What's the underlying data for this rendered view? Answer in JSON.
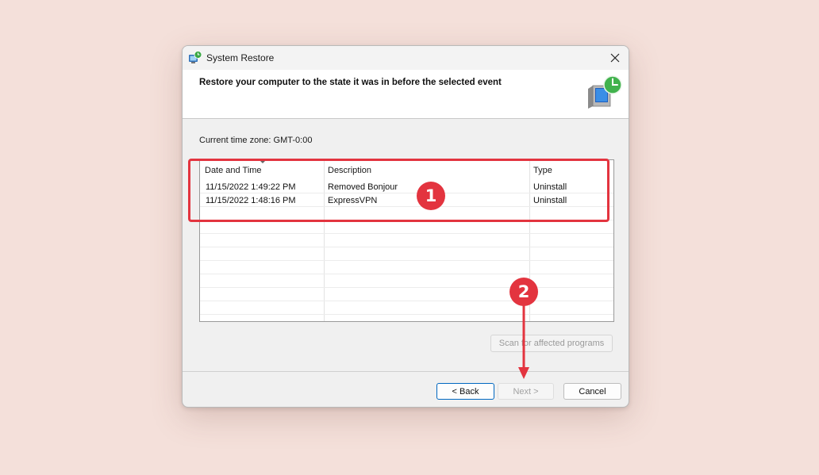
{
  "window": {
    "title": "System Restore",
    "close_icon": "close-icon"
  },
  "header": {
    "text": "Restore your computer to the state it was in before the selected event",
    "icon": "system-restore-icon"
  },
  "timezone_label": "Current time zone: GMT-0:00",
  "restore_points": {
    "columns": [
      "Date and Time",
      "Description",
      "Type"
    ],
    "rows": [
      [
        "11/15/2022 1:49:22 PM",
        "Removed Bonjour",
        "Uninstall"
      ],
      [
        "11/15/2022 1:48:16 PM",
        "ExpressVPN",
        "Uninstall"
      ]
    ]
  },
  "buttons": {
    "scan": "Scan for affected programs",
    "back": "< Back",
    "next": "Next >",
    "cancel": "Cancel"
  },
  "annotations": {
    "badge_1": "1",
    "badge_2": "2",
    "accent_color": "#e3343f"
  }
}
